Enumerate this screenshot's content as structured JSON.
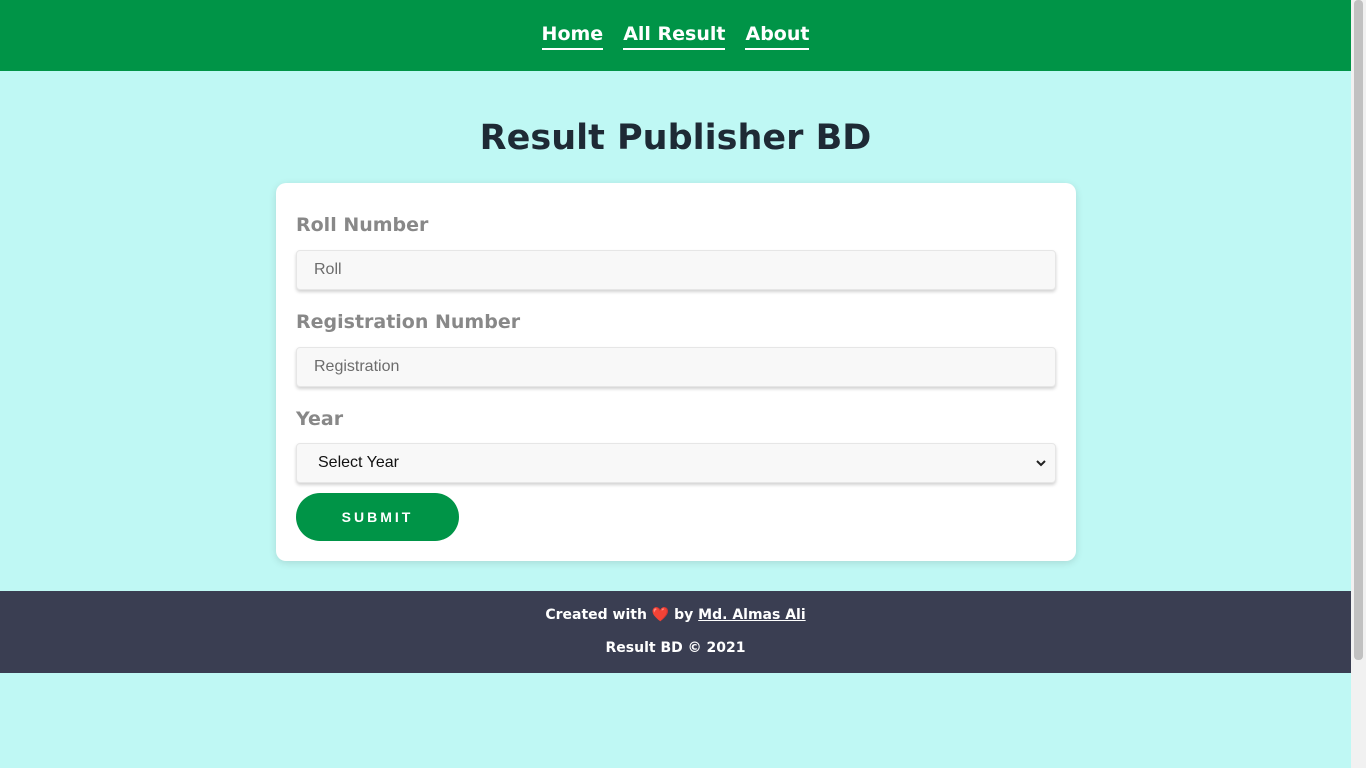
{
  "nav": {
    "items": [
      {
        "label": "Home"
      },
      {
        "label": "All Result"
      },
      {
        "label": "About"
      }
    ]
  },
  "page_title": "Result Publisher BD",
  "form": {
    "roll_label": "Roll Number",
    "roll_placeholder": "Roll",
    "registration_label": "Registration Number",
    "registration_placeholder": "Registration",
    "year_label": "Year",
    "year_selected": "Select Year",
    "submit_label": "SUBMIT"
  },
  "footer": {
    "created_prefix": "Created with",
    "heart": "❤️",
    "by": "by",
    "author": "Md. Almas Ali",
    "copyright": "Result BD © 2021"
  },
  "colors": {
    "nav_bg": "#009447",
    "page_bg": "#bff8f4",
    "footer_bg": "#3a3e52",
    "accent": "#009447"
  }
}
